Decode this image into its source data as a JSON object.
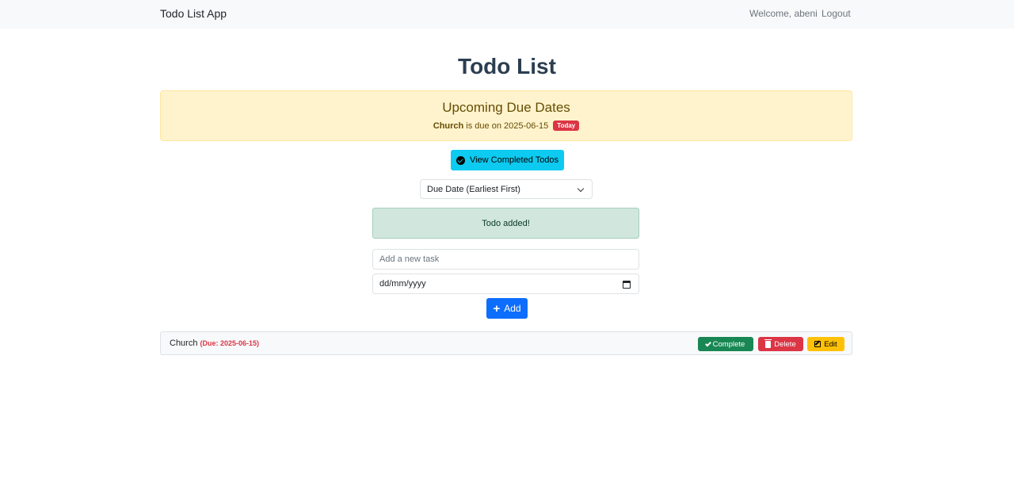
{
  "navbar": {
    "brand": "Todo List App",
    "welcome": "Welcome, abeni",
    "logout": "Logout"
  },
  "page": {
    "title": "Todo List"
  },
  "due_alert": {
    "heading": "Upcoming Due Dates",
    "task_name": "Church",
    "middle_text": " is due on 2025-06-15",
    "badge": "Today"
  },
  "buttons": {
    "view_completed": "View Completed Todos",
    "add": "Add"
  },
  "sort": {
    "selected": "Due Date (Earliest First)"
  },
  "flash": {
    "message": "Todo added!"
  },
  "form": {
    "task_placeholder": "Add a new task",
    "date_placeholder": "dd/mm/yyyy"
  },
  "todos": [
    {
      "title": "Church",
      "due": "(Due: 2025-06-15)",
      "complete_label": "Complete",
      "delete_label": "Delete",
      "edit_label": "Edit"
    }
  ],
  "colors": {
    "primary": "#0d6efd",
    "info": "#0dcaf0",
    "success": "#198754",
    "danger": "#dc3545",
    "warning": "#ffc107",
    "warning_bg": "#fff3cd",
    "success_bg": "#d1e7dd"
  }
}
